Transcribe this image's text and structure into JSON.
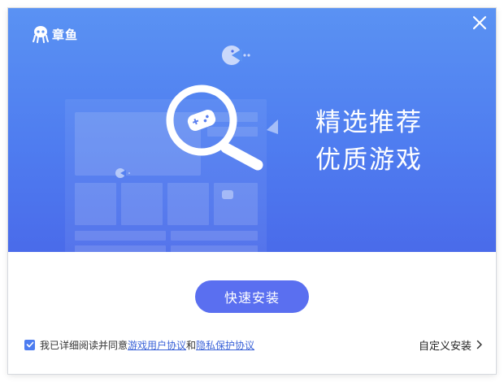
{
  "app": {
    "logo_text": "章鱼"
  },
  "banner": {
    "headline_line1": "精选推荐",
    "headline_line2": "优质游戏"
  },
  "install": {
    "button_label": "快速安装"
  },
  "agreement": {
    "checked": true,
    "prefix": "我已详细阅读并同意",
    "link1": "游戏用户协议",
    "connector": "和",
    "link2": "隐私保护协议"
  },
  "custom": {
    "label": "自定义安装"
  },
  "colors": {
    "banner_top": "#5a92f3",
    "banner_bottom": "#4a6bea",
    "button": "#5a6ff0",
    "link": "#3b63d8"
  },
  "icons": [
    "octopus-logo-icon",
    "close-icon",
    "magnifier-icon",
    "gamepad-icon",
    "pacman-icon",
    "checkbox-checked-icon",
    "chevron-right-icon"
  ]
}
